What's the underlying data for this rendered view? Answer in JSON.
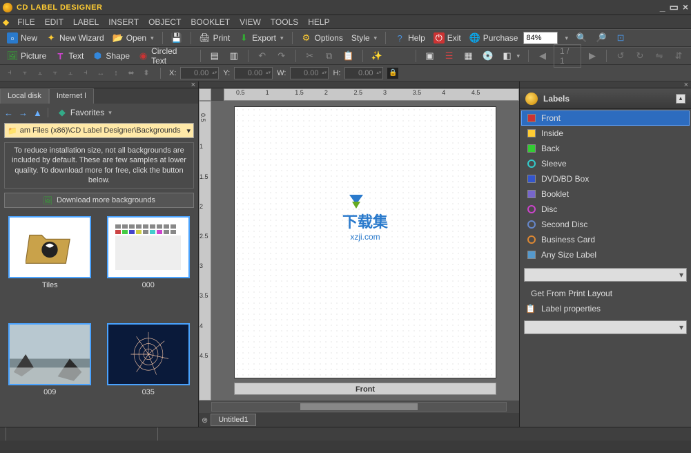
{
  "title": "CD LABEL DESIGNER",
  "menu": [
    "File",
    "Edit",
    "Label",
    "Insert",
    "Object",
    "Booklet",
    "View",
    "Tools",
    "Help"
  ],
  "toolbar1": {
    "new": "New",
    "wizard": "New Wizard",
    "open": "Open",
    "print": "Print",
    "export": "Export",
    "options": "Options",
    "style": "Style",
    "help": "Help",
    "exit": "Exit",
    "purchase": "Purchase",
    "zoom": "84%"
  },
  "toolbar2": {
    "picture": "Picture",
    "text": "Text",
    "shape": "Shape",
    "circled": "Circled Text",
    "page_indicator": "1 / 1"
  },
  "coords": {
    "x_lbl": "X:",
    "x": "0.00",
    "y_lbl": "Y:",
    "y": "0.00",
    "w_lbl": "W:",
    "w": "0.00",
    "h_lbl": "H:",
    "h": "0.00"
  },
  "left": {
    "tabs": [
      "Local disk",
      "Internet l"
    ],
    "favorites": "Favorites",
    "path": "am Files (x86)\\CD Label Designer\\Backgrounds",
    "info": "To reduce installation size, not all backgrounds are included by default. These are few samples at lower quality. To download more for free, click the button below.",
    "download_btn": "Download more backgrounds",
    "thumbs": [
      {
        "name": "Tiles"
      },
      {
        "name": "000"
      },
      {
        "name": "009"
      },
      {
        "name": "035"
      }
    ]
  },
  "canvas": {
    "page_label": "Front",
    "doc_tab": "Untitled1",
    "watermark_cn": "下载集",
    "watermark_url": "xzji.com",
    "ruler_ticks": [
      "0.5",
      "1",
      "1.5",
      "2",
      "2.5",
      "3",
      "3.5",
      "4",
      "4.5"
    ]
  },
  "right": {
    "title": "Labels",
    "items": [
      {
        "label": "Front",
        "color": "#cc3333",
        "selected": true
      },
      {
        "label": "Inside",
        "color": "#ffcc33"
      },
      {
        "label": "Back",
        "color": "#33cc33"
      },
      {
        "label": "Sleeve",
        "color": "#33cccc",
        "ring": true
      },
      {
        "label": "DVD/BD Box",
        "color": "#3355cc"
      },
      {
        "label": "Booklet",
        "color": "#7766cc"
      },
      {
        "label": "Disc",
        "color": "#cc44cc",
        "ring": true
      },
      {
        "label": "Second Disc",
        "color": "#6688cc",
        "ring": true
      },
      {
        "label": "Business Card",
        "color": "#dd8833",
        "ring": true
      },
      {
        "label": "Any Size Label",
        "color": "#5599cc"
      }
    ],
    "get_layout": "Get From Print Layout",
    "props": "Label properties"
  }
}
